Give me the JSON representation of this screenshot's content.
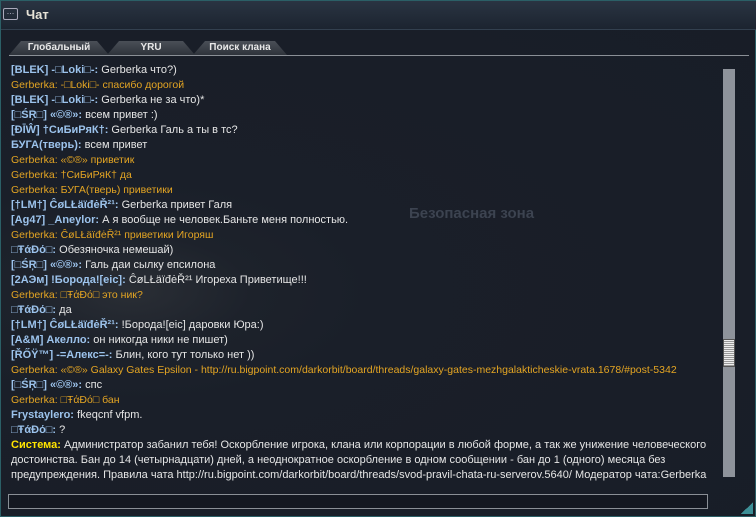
{
  "window": {
    "title": "Чат",
    "icon": "chat-bubble-icon"
  },
  "tabs": [
    {
      "label": "Глобальный",
      "active": true
    },
    {
      "label": "YRU",
      "active": false
    },
    {
      "label": "Поиск клана",
      "active": false
    }
  ],
  "background_watermark": "Безопасная зона",
  "messages": [
    {
      "type": "user",
      "name": "[BLEK] -□Loki□-:",
      "text": " Gerberka что?)"
    },
    {
      "type": "mod",
      "text": "Gerberka:  -□Loki□-   спасибо дорогой"
    },
    {
      "type": "user",
      "name": "[BLEK] -□Loki□-:",
      "text": " Gerberka не за что)*"
    },
    {
      "type": "user",
      "name": "[□ŚŖ□] «©®»:",
      "text": " всем привет :)"
    },
    {
      "type": "user",
      "name": "[ĐĪŴ] †СиБиРяК†:",
      "text": " Gerberka Галь а ты в тс?"
    },
    {
      "type": "user",
      "name": "БУГА(тверь):",
      "text": " всем привет"
    },
    {
      "type": "mod",
      "text": "Gerberka:  «©®»  приветик"
    },
    {
      "type": "mod",
      "text": "Gerberka:  †СиБиРяК† да"
    },
    {
      "type": "mod",
      "text": "Gerberka:  БУГА(тверь) приветики"
    },
    {
      "type": "user",
      "name": "[†LM†] ĈøLŁäïđėŘ²¹:",
      "text": " Gerberka привет Галя"
    },
    {
      "type": "user",
      "name": "[Ag47] _Aneylor:",
      "text": " А я вообще не человек.Баньте меня полностью."
    },
    {
      "type": "mod",
      "text": "Gerberka:  ĈøLŁäïđėŘ²¹  приветики Игоряш"
    },
    {
      "type": "user",
      "name": "□ŦάĐό□:",
      "text": " Обезяночка немешай)"
    },
    {
      "type": "user",
      "name": "[□ŚŖ□] «©®»:",
      "text": " Галь даи сылку епсилона"
    },
    {
      "type": "user",
      "name": "[2АЭм] !Борода![eic]:",
      "text": " ĈøLŁäïđėŘ²¹  Игореха Приветище!!!"
    },
    {
      "type": "mod",
      "text": "Gerberka:  □ŦάĐό□ это ник?"
    },
    {
      "type": "user",
      "name": "□ŦάĐό□:",
      "text": " да"
    },
    {
      "type": "user",
      "name": "[†LM†] ĈøLŁäïđėŘ²¹:",
      "text": " !Борода![eic] даровки Юра:)"
    },
    {
      "type": "user",
      "name": "[A&M] Акелло:",
      "text": " он никогда ники не пишет)"
    },
    {
      "type": "user",
      "name": "[ŘŐŸ™] -=Алекс=-:",
      "text": " Блин, кого тут только нет ))"
    },
    {
      "type": "mod",
      "text": "Gerberka:  «©®» Galaxy Gates Epsilon -   http://ru.bigpoint.com/darkorbit/board/threads/galaxy-gates-mezhgalakticheskie-vrata.1678/#post-5342"
    },
    {
      "type": "user",
      "name": "[□ŚŖ□] «©®»:",
      "text": " спс"
    },
    {
      "type": "mod",
      "text": "Gerberka:  □ŦάĐό□  бан"
    },
    {
      "type": "user",
      "name": "Frystaylero:",
      "text": " fkeqcnf vfpm."
    },
    {
      "type": "user",
      "name": "□ŦάĐό□:",
      "text": " ?"
    },
    {
      "type": "system",
      "name": "Система:",
      "text": " Администратор забанил тебя! Оскорбление игрока, клана или корпорации в любой форме, а так же унижение человеческого достоинства. Бан до 14 (четырнадцати) дней, а неоднократное оскорбление в одном сообщении - бан до 1 (одного) месяца без предупреждения. Правила чата http://ru.bigpoint.com/darkorbit/board/threads/svod-pravil-chata-ru-serverov.5640/ Модератор чата:Gerberka"
    }
  ],
  "input": {
    "value": ""
  },
  "scrollbar": {
    "position_fraction": 0.7
  },
  "colors": {
    "username": "#9cc3ec",
    "moderator": "#e4a523",
    "system": "#ffe400",
    "text": "#e6e6e6"
  }
}
